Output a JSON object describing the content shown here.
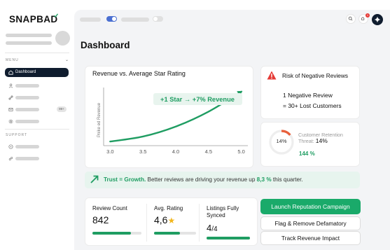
{
  "app": {
    "name": "SNAPBAD",
    "accent": "#1f9d62",
    "nav_dark": "#0f1c2e"
  },
  "sidebar": {
    "menu_label": "MENU",
    "support_label": "SUPPORT",
    "active_item": {
      "label": "Dashboard",
      "icon": "home-icon"
    },
    "badge": "99+"
  },
  "page": {
    "title": "Dashboard"
  },
  "chart": {
    "title": "Revenue vs. Average Star Rating",
    "annotation": "+1 Star → +7% Revenue",
    "ylabel": "Revenue",
    "ylabel_prefix": "Pnike ed"
  },
  "chart_data": {
    "type": "line",
    "title": "Revenue vs. Average Star Rating",
    "xlabel": "",
    "ylabel": "Revenue",
    "x": [
      3.0,
      3.5,
      4.0,
      4.5,
      5.0
    ],
    "x_ticks": [
      "3.0",
      "3.5",
      "4.0",
      "4.5",
      "5.0"
    ],
    "xlim": [
      2.9,
      5.1
    ],
    "series": [
      {
        "color": "#1f9d62",
        "x": [
          3.0,
          3.5,
          4.0,
          4.5,
          5.0
        ],
        "y": [
          1,
          2.2,
          4.6,
          8.2,
          13
        ]
      }
    ],
    "ylim": [
      0,
      14
    ],
    "y_ticks_shown": false,
    "annotations": [
      "+1 Star → +7% Revenue"
    ]
  },
  "risk": {
    "title": "Risk of Negative Reviews",
    "line1": "1 Negative Review",
    "line2": "= 30+ Lost Customers"
  },
  "retention": {
    "percent": "14%",
    "percent_value": 14,
    "label": "Customer Retention Threat:",
    "value": "14%",
    "growth": "144 %",
    "ring_color": "#e8603c"
  },
  "banner": {
    "lead": "Trust = Growth.",
    "text": " Better reviews are driving your revenue up ",
    "highlight": "8,3 %",
    "tail": " this quarter."
  },
  "stats": {
    "review_count": {
      "label": "Review Count",
      "value": "842",
      "progress": 0.78
    },
    "avg_rating": {
      "label": "Avg. Rating",
      "value": "4,6",
      "progress": 0.62
    },
    "listings": {
      "label": "Listings Fully Synced",
      "value": "4",
      "total": "/4",
      "progress": 1.0
    }
  },
  "actions": {
    "primary": "Launch Reputation Campaign",
    "flag": "Flag & Remove Defamatory",
    "track": "Track Revenue Impact"
  },
  "topbar": {
    "icons": [
      "search-icon",
      "bell-icon",
      "sparkle-icon"
    ],
    "notification_count": "1"
  }
}
